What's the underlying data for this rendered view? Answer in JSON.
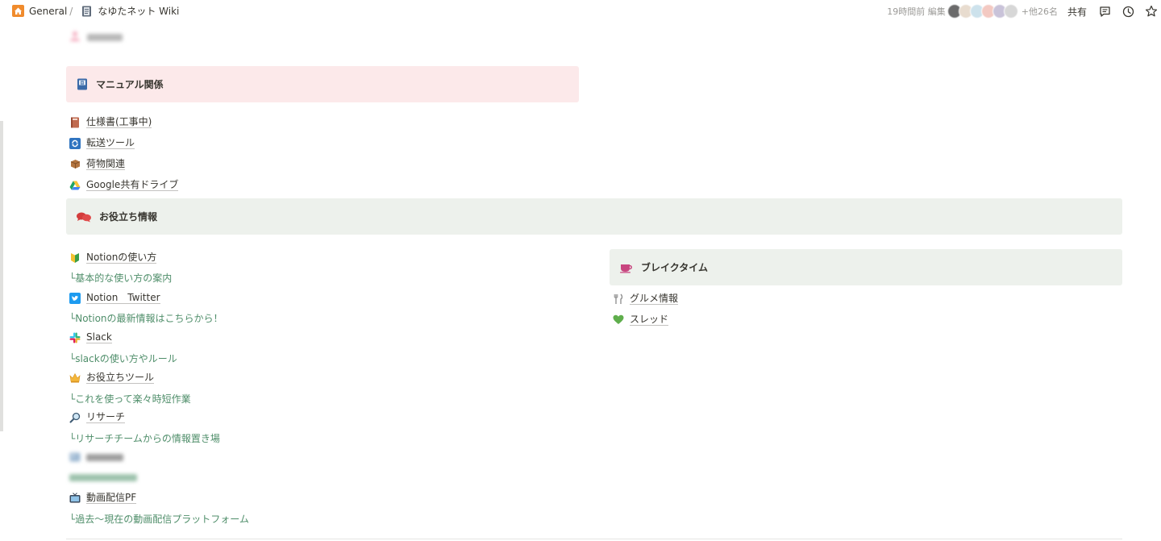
{
  "breadcrumb": {
    "items": [
      {
        "label": "General",
        "icon": "home-icon"
      },
      {
        "label": "なゆたネット Wiki",
        "icon": "notebook-icon"
      }
    ],
    "separator": "/"
  },
  "topbar": {
    "edited_label": "19時間前 編集",
    "others_label": "+他26名",
    "share_label": "共有",
    "icons": [
      "comment-icon",
      "history-icon",
      "star-icon"
    ]
  },
  "sections": {
    "manual": {
      "title": "マニュアル関係",
      "bg": "#fce9ea",
      "links": [
        {
          "label": "仕様書(工事中)",
          "icon": "book-icon"
        },
        {
          "label": "転送ツール",
          "icon": "sync-icon"
        },
        {
          "label": "荷物関連",
          "icon": "package-icon"
        },
        {
          "label": "Google共有ドライブ",
          "icon": "google-drive-icon"
        }
      ]
    },
    "useful": {
      "title": "お役立ち情報",
      "bg": "#edf1ec",
      "items": [
        {
          "label": "Notionの使い方",
          "icon": "beginner-icon",
          "desc": "└基本的な使い方の案内"
        },
        {
          "label": "Notion　Twitter",
          "icon": "twitter-icon",
          "desc": "└Notionの最新情報はこちらから！"
        },
        {
          "label": "Slack",
          "icon": "slack-icon",
          "desc": "└slackの使い方やルール"
        },
        {
          "label": "お役立ちツール",
          "icon": "crown-icon",
          "desc": "└これを使って楽々時短作業"
        },
        {
          "label": "リサーチ",
          "icon": "magnifier-icon",
          "desc": "└リサーチチームからの情報置き場"
        },
        {
          "label": "",
          "icon": "image-icon",
          "desc": ""
        },
        {
          "label": "動画配信PF",
          "icon": "tv-icon",
          "desc": "└過去～現在の動画配信プラットフォーム"
        }
      ]
    },
    "break": {
      "title": "ブレイクタイム",
      "bg": "#edf1ec",
      "links": [
        {
          "label": "グルメ情報",
          "icon": "fork-knife-icon"
        },
        {
          "label": "スレッド",
          "icon": "green-heart-icon"
        }
      ]
    }
  },
  "colors": {
    "accent_desc": "#4f8e6a",
    "text": "#37352f",
    "muted": "#9b9a97"
  }
}
